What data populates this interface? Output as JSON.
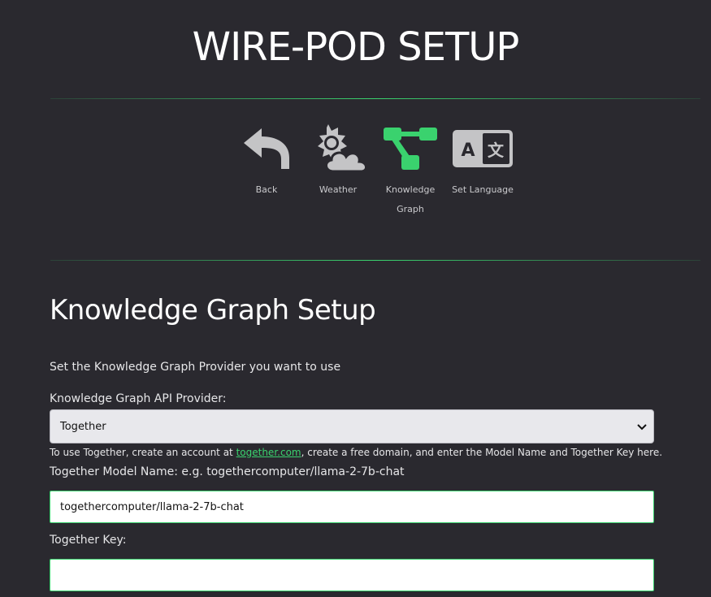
{
  "header": {
    "title": "WIRE-POD SETUP"
  },
  "nav": {
    "items": [
      {
        "label": "Back",
        "icon": "back-arrow-icon"
      },
      {
        "label": "Weather",
        "icon": "weather-icon"
      },
      {
        "label_line1": "Knowledge",
        "label_line2": "Graph",
        "icon": "knowledge-graph-icon"
      },
      {
        "label": "Set Language",
        "icon": "language-icon"
      }
    ],
    "active_color": "#3ad26e",
    "icon_color": "#c4c4c6"
  },
  "main": {
    "title": "Knowledge Graph Setup",
    "intro": "Set the Knowledge Graph Provider you want to use",
    "provider": {
      "label": "Knowledge Graph API Provider:",
      "selected": "Together"
    },
    "hint": {
      "prefix": "To use Together, create an account at ",
      "link": "together.com",
      "suffix": ", create a free domain, and enter the Model Name and Together Key here."
    },
    "model": {
      "label": "Together Model Name: e.g. togethercomputer/llama-2-7b-chat",
      "value": "togethercomputer/llama-2-7b-chat"
    },
    "key": {
      "label": "Together Key:",
      "value": ""
    }
  }
}
